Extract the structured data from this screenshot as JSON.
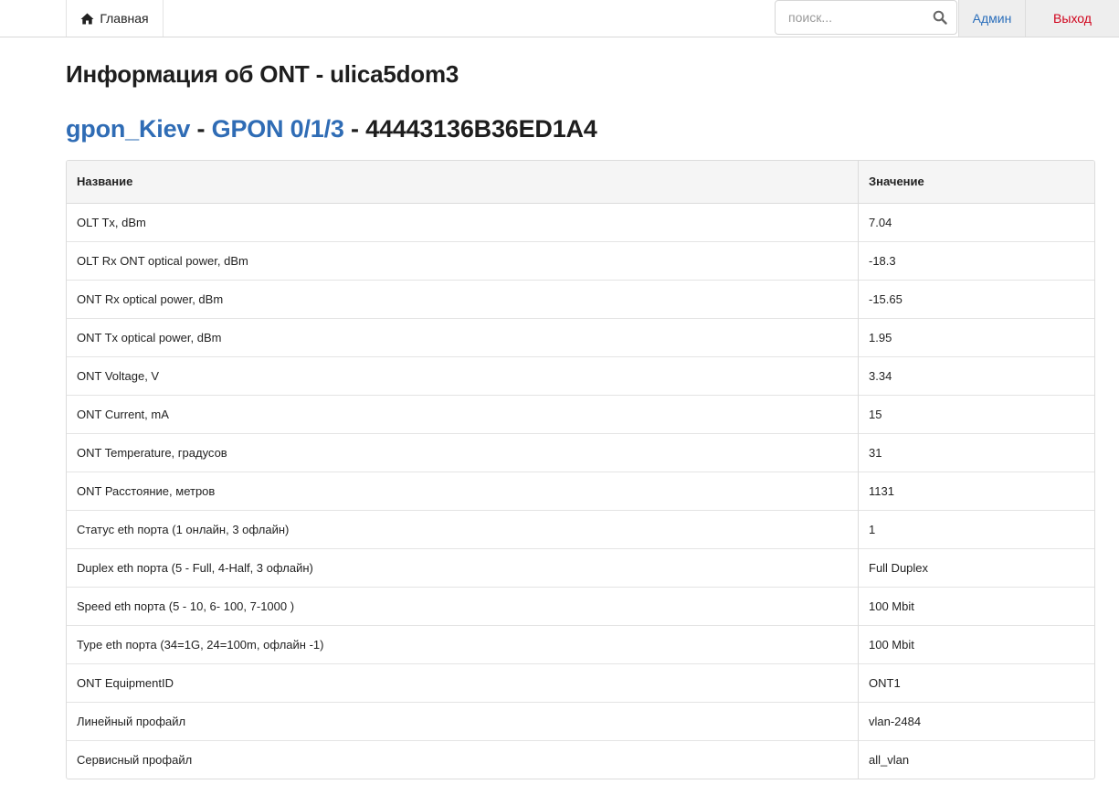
{
  "nav": {
    "home_label": "Главная",
    "search_placeholder": "поиск...",
    "admin_label": "Админ",
    "logout_label": "Выход"
  },
  "page": {
    "title": "Информация об ONT - ulica5dom3",
    "olt_link": "gpon_Kiev",
    "sep1": " - ",
    "port_link": "GPON 0/1/3",
    "sep2": " - ",
    "serial": "44443136B36ED1A4"
  },
  "table": {
    "headers": [
      "Название",
      "Значение"
    ],
    "rows": [
      [
        "OLT Tx, dBm",
        "7.04"
      ],
      [
        "OLT Rx ONT optical power, dBm",
        "-18.3"
      ],
      [
        "ONT Rx optical power, dBm",
        "-15.65"
      ],
      [
        "ONT Tx optical power, dBm",
        "1.95"
      ],
      [
        "ONT Voltage, V",
        "3.34"
      ],
      [
        "ONT Current, mA",
        "15"
      ],
      [
        "ONT Temperature, градусов",
        "31"
      ],
      [
        "ONT Расстояние, метров",
        "1131"
      ],
      [
        "Статус eth порта (1 онлайн, 3 офлайн)",
        "1"
      ],
      [
        "Duplex eth порта (5 - Full, 4-Half, 3 офлайн)",
        "Full Duplex"
      ],
      [
        "Speed eth порта (5 - 10, 6- 100, 7-1000 )",
        "100 Mbit"
      ],
      [
        "Type eth порта (34=1G, 24=100m, офлайн -1)",
        "100 Mbit"
      ],
      [
        "ONT EquipmentID",
        "ONT1"
      ],
      [
        "Линейный профайл",
        "vlan-2484"
      ],
      [
        "Сервисный профайл",
        "all_vlan"
      ]
    ]
  }
}
